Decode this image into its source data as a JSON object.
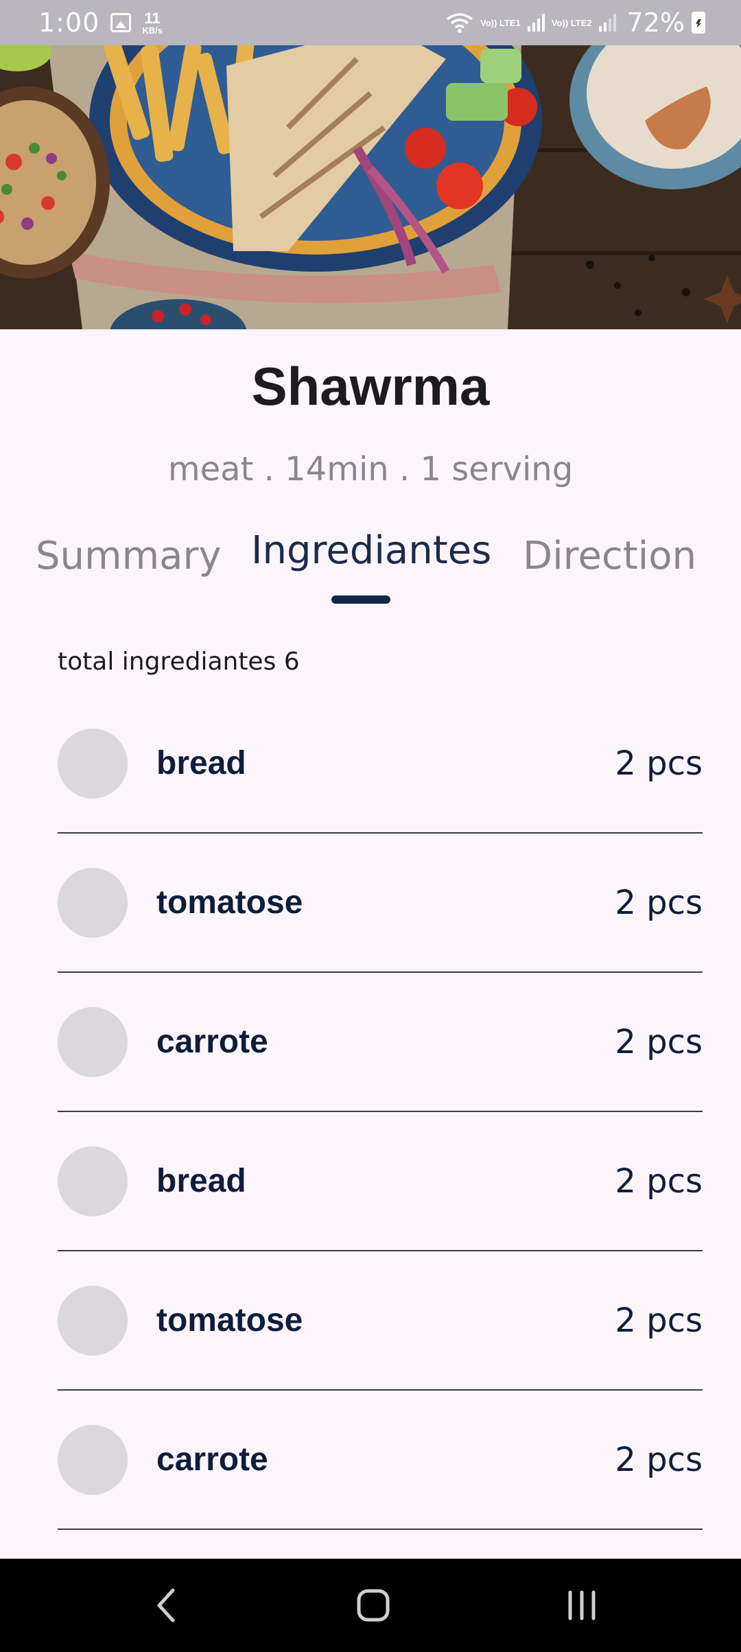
{
  "status_bar": {
    "time": "1:00",
    "speed_value": "11",
    "speed_unit": "KB/s",
    "lte1": "Vo)) LTE1",
    "lte2": "Vo)) LTE2",
    "battery": "72%"
  },
  "recipe": {
    "title": "Shawrma",
    "meta": "meat . 14min . 1 serving"
  },
  "tabs": [
    {
      "label": "Summary",
      "active": false
    },
    {
      "label": "Ingrediantes",
      "active": true
    },
    {
      "label": "Direction",
      "active": false
    }
  ],
  "ingredients": {
    "total_label": "total ingrediantes 6",
    "items": [
      {
        "name": "bread",
        "qty": "2 pcs"
      },
      {
        "name": "tomatose",
        "qty": "2 pcs"
      },
      {
        "name": "carrote",
        "qty": "2 pcs"
      },
      {
        "name": "bread",
        "qty": "2 pcs"
      },
      {
        "name": "tomatose",
        "qty": "2 pcs"
      },
      {
        "name": "carrote",
        "qty": "2 pcs"
      }
    ]
  },
  "nav": {
    "back_icon": "back-chevron-icon",
    "home_icon": "home-icon",
    "recents_icon": "recents-icon"
  },
  "colors": {
    "background": "#fcf5fb",
    "accent": "#14254a",
    "text_muted": "#8a8690"
  }
}
